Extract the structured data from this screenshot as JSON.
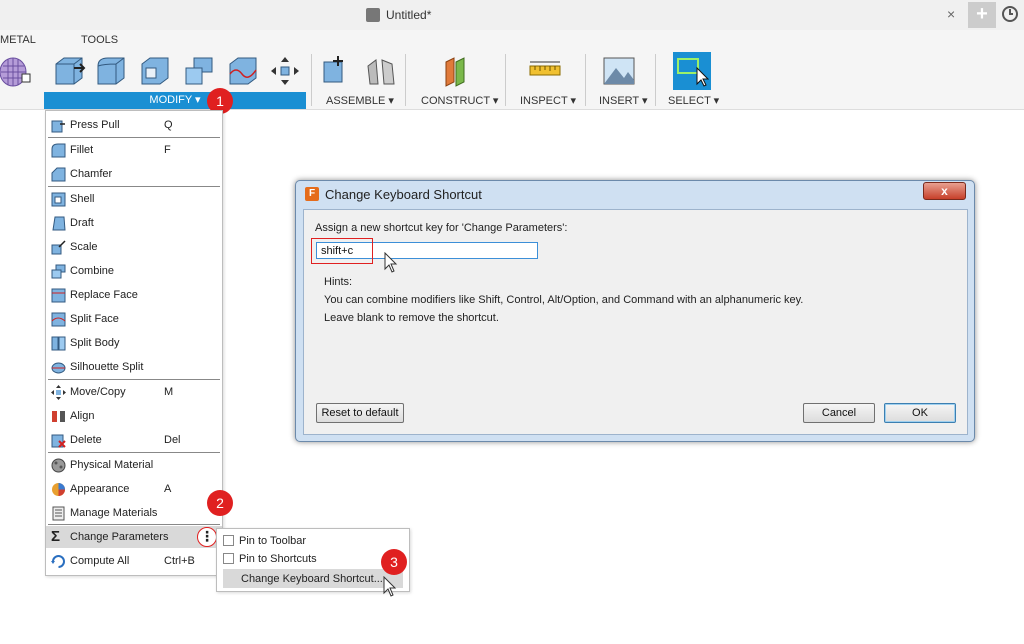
{
  "window": {
    "title": "Untitled*",
    "close": "×",
    "new_tab": "+"
  },
  "tabs": [
    "METAL",
    "TOOLS"
  ],
  "groups": {
    "modify": "MODIFY ▾",
    "assemble": "ASSEMBLE ▾",
    "construct": "CONSTRUCT ▾",
    "inspect": "INSPECT ▾",
    "insert": "INSERT ▾",
    "select": "SELECT ▾"
  },
  "badges": {
    "one": "1",
    "two": "2",
    "three": "3"
  },
  "menu": {
    "items": [
      {
        "label": "Press Pull",
        "key": "Q"
      },
      {
        "label": "Fillet",
        "key": "F"
      },
      {
        "label": "Chamfer",
        "key": ""
      },
      {
        "label": "Shell",
        "key": ""
      },
      {
        "label": "Draft",
        "key": ""
      },
      {
        "label": "Scale",
        "key": ""
      },
      {
        "label": "Combine",
        "key": ""
      },
      {
        "label": "Replace Face",
        "key": ""
      },
      {
        "label": "Split Face",
        "key": ""
      },
      {
        "label": "Split Body",
        "key": ""
      },
      {
        "label": "Silhouette Split",
        "key": ""
      },
      {
        "label": "Move/Copy",
        "key": "M"
      },
      {
        "label": "Align",
        "key": ""
      },
      {
        "label": "Delete",
        "key": "Del"
      },
      {
        "label": "Physical Material",
        "key": ""
      },
      {
        "label": "Appearance",
        "key": "A"
      },
      {
        "label": "Manage Materials",
        "key": ""
      },
      {
        "label": "Change Parameters",
        "key": ""
      },
      {
        "label": "Compute All",
        "key": "Ctrl+B"
      }
    ],
    "more": "⋮"
  },
  "submenu": {
    "pin_toolbar": "Pin to Toolbar",
    "pin_shortcuts": "Pin to Shortcuts",
    "change_shortcut": "Change Keyboard Shortcut..."
  },
  "dialog": {
    "title": "Change Keyboard Shortcut",
    "icon_letter": "F",
    "prompt": "Assign a new shortcut key for 'Change Parameters':",
    "input_value": "shift+c",
    "hints_label": "Hints:",
    "hint1": "You can combine modifiers like Shift, Control, Alt/Option, and Command with an alphanumeric key.",
    "hint2": "Leave blank to remove the shortcut.",
    "reset": "Reset to default",
    "cancel": "Cancel",
    "ok": "OK",
    "close": "x"
  },
  "colors": {
    "accent": "#1a8fd3",
    "badge": "#e02020",
    "dialog_frame": "#cfe0f2"
  }
}
